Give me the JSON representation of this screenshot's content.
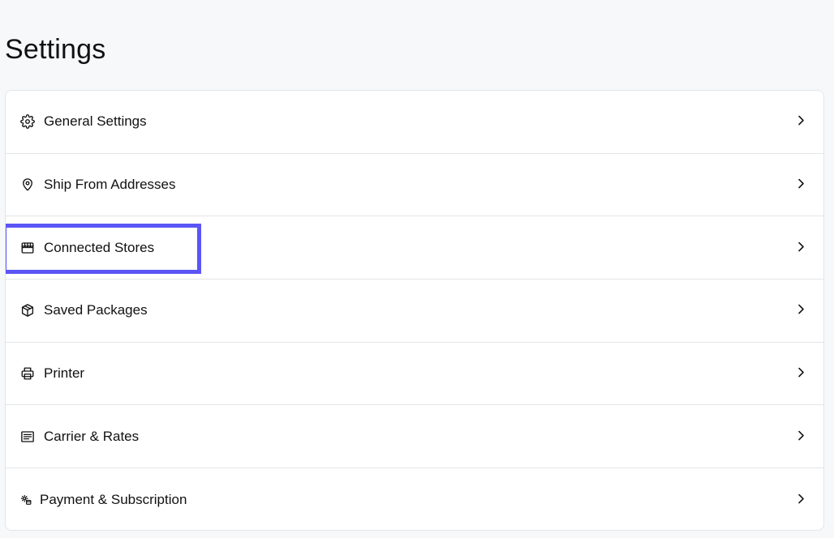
{
  "page": {
    "title": "Settings"
  },
  "settings": {
    "items": [
      {
        "label": "General Settings",
        "icon": "gear-icon"
      },
      {
        "label": "Ship From Addresses",
        "icon": "location-pin-icon"
      },
      {
        "label": "Connected Stores",
        "icon": "store-icon"
      },
      {
        "label": "Saved Packages",
        "icon": "package-icon"
      },
      {
        "label": "Printer",
        "icon": "printer-icon"
      },
      {
        "label": "Carrier & Rates",
        "icon": "list-icon"
      },
      {
        "label": "Payment & Subscription",
        "icon": "payment-gear-icon"
      }
    ]
  },
  "colors": {
    "highlight": "#5b55f5",
    "background": "#f7f8fa",
    "card": "#ffffff",
    "border": "#e3e5e8"
  }
}
